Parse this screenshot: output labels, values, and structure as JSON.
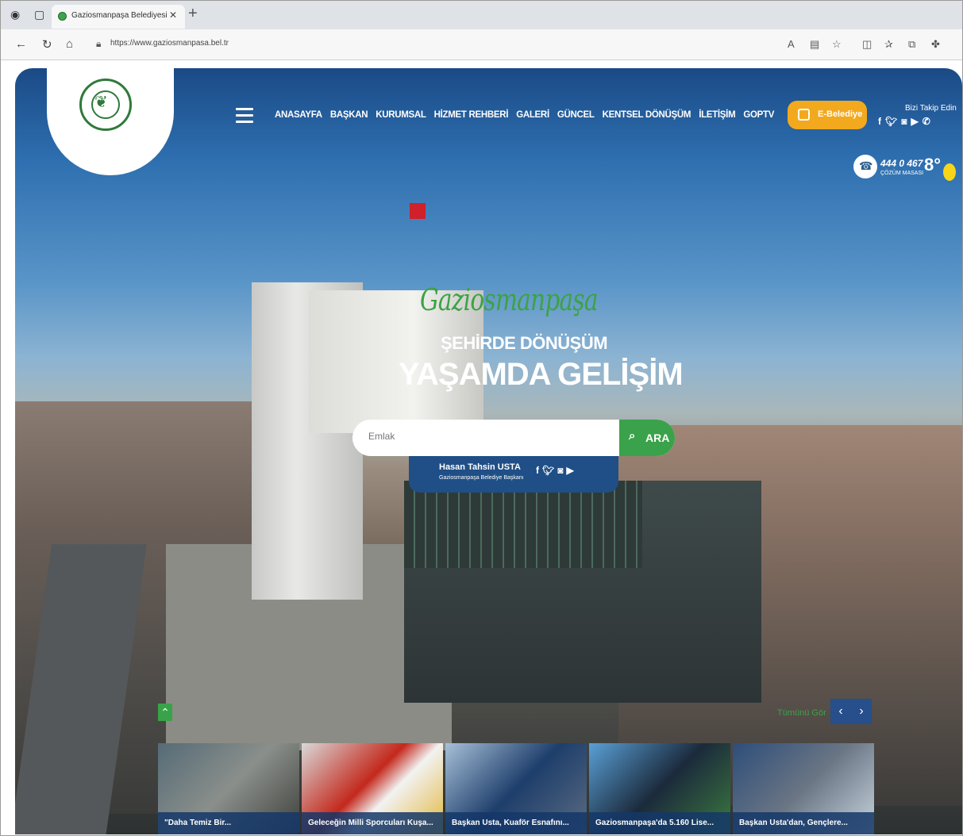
{
  "browser": {
    "tab_title": "Gaziosmanpaşa Belediyesi",
    "url": "https://www.gaziosmanpasa.bel.tr"
  },
  "header": {
    "nav": [
      "ANASAYFA",
      "BAŞKAN",
      "KURUMSAL",
      "HİZMET REHBERİ",
      "GALERİ",
      "GÜNCEL",
      "KENTSEL DÖNÜŞÜM",
      "İLETİŞİM",
      "GOPTV"
    ],
    "ebelediye_label": "E-Belediye",
    "follow_label": "Bizi Takip Edin",
    "phone": "444 0 467",
    "phone_sub": "ÇÖZÜM MASASI",
    "temperature": "8°"
  },
  "hero": {
    "script": "Gaziosmanpaşa",
    "line1": "ŞEHİRDE DÖNÜŞÜM",
    "line2": "YAŞAMDA GELİŞİM"
  },
  "search": {
    "placeholder": "Emlak",
    "button_label": "ARA"
  },
  "mayor": {
    "name": "Hasan Tahsin USTA",
    "role": "Gaziosmanpaşa Belediye Başkanı"
  },
  "news": {
    "see_all": "Tümünü Gör",
    "items": [
      "\"Daha Temiz Bir...",
      "Geleceğin Milli Sporcuları Kuşa...",
      "Başkan Usta, Kuaför Esnafını...",
      "Gaziosmanpaşa'da 5.160 Lise...",
      "Başkan Usta'dan, Gençlere..."
    ]
  },
  "colors": {
    "brand_green": "#3aa24a",
    "brand_blue": "#1f4f86",
    "ebelediye_orange": "#f3a91d"
  }
}
